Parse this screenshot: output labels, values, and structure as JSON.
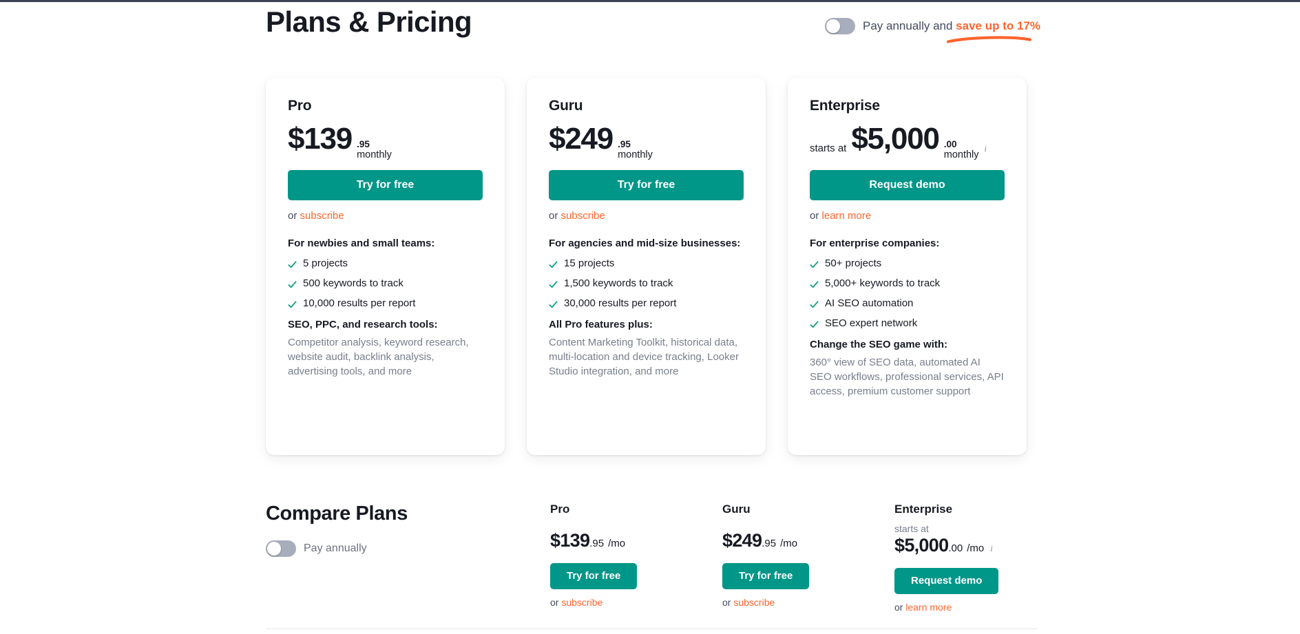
{
  "header": {
    "title": "Plans & Pricing",
    "annual_toggle": {
      "state": "off",
      "prefix": "Pay annually and ",
      "highlight": "save up to 17%",
      "icon": "toggle-switch-icon"
    }
  },
  "colors": {
    "cta_green": "#009688",
    "accent_orange": "#ff642d",
    "check_green": "#16a085",
    "text_dark": "#171a22",
    "text_muted": "#787e8c"
  },
  "plans": [
    {
      "name": "Pro",
      "starts_at": "",
      "price": "$139",
      "cents": ".95",
      "period": "monthly",
      "has_info_icon": false,
      "cta_label": "Try for free",
      "sub_prefix": "or ",
      "sub_link": "subscribe",
      "audience_head": "For newbies and small teams:",
      "features": [
        "5 projects",
        "500 keywords to track",
        "10,000 results per report"
      ],
      "block_head": "SEO, PPC, and research tools:",
      "block_body": "Competitor analysis, keyword research, website audit, backlink analysis, advertising tools, and more"
    },
    {
      "name": "Guru",
      "starts_at": "",
      "price": "$249",
      "cents": ".95",
      "period": "monthly",
      "has_info_icon": false,
      "cta_label": "Try for free",
      "sub_prefix": "or ",
      "sub_link": "subscribe",
      "audience_head": "For agencies and mid-size businesses:",
      "features": [
        "15 projects",
        "1,500 keywords to track",
        "30,000 results per report"
      ],
      "block_head": "All Pro features plus:",
      "block_body": "Content Marketing Toolkit, historical data, multi-location and device tracking, Looker Studio integration, and more"
    },
    {
      "name": "Enterprise",
      "starts_at": "starts at",
      "price": "$5,000",
      "cents": ".00",
      "period": "monthly",
      "has_info_icon": true,
      "info_icon": "info-icon",
      "cta_label": "Request demo",
      "sub_prefix": "or ",
      "sub_link": "learn more",
      "audience_head": "For enterprise companies:",
      "features": [
        "50+ projects",
        "5,000+ keywords to track",
        "AI SEO automation",
        "SEO expert network"
      ],
      "block_head": "Change the SEO game with:",
      "block_body": "360° view of SEO data, automated AI SEO workflows, professional services, API access, premium customer support"
    }
  ],
  "compare": {
    "title": "Compare Plans",
    "toggle_label": "Pay annually",
    "toggle_state": "off",
    "columns": [
      {
        "name": "Pro",
        "starts_at": "",
        "price": "$139",
        "cents": ".95",
        "per": "/mo",
        "has_info_icon": false,
        "cta_label": "Try for free",
        "sub_prefix": "or ",
        "sub_link": "subscribe"
      },
      {
        "name": "Guru",
        "starts_at": "",
        "price": "$249",
        "cents": ".95",
        "per": "/mo",
        "has_info_icon": false,
        "cta_label": "Try for free",
        "sub_prefix": "or ",
        "sub_link": "subscribe"
      },
      {
        "name": "Enterprise",
        "starts_at": "starts at",
        "price": "$5,000",
        "cents": ".00",
        "per": "/mo",
        "has_info_icon": true,
        "info_icon": "info-icon",
        "cta_label": "Request demo",
        "sub_prefix": "or ",
        "sub_link": "learn more"
      }
    ]
  }
}
